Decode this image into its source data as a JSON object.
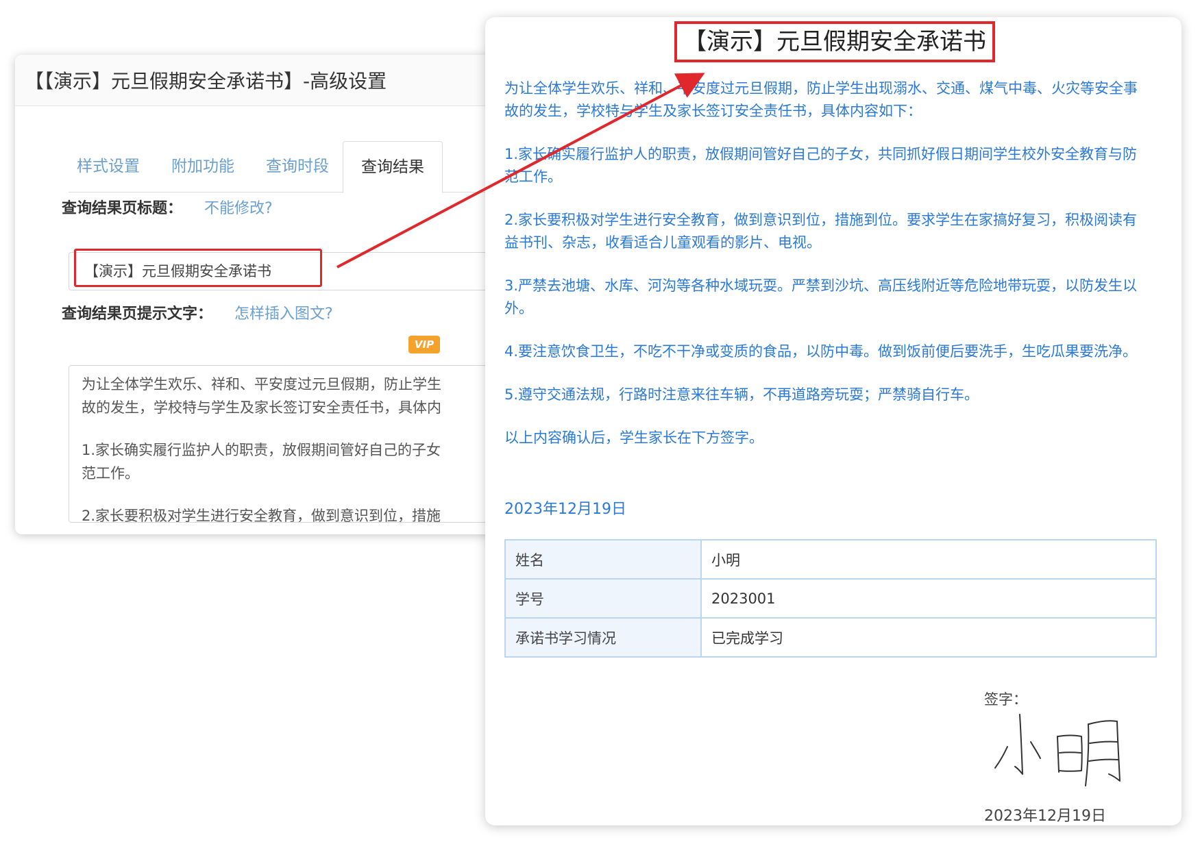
{
  "settings": {
    "header_title": "【【演示】元旦假期安全承诺书】-高级设置",
    "tabs": [
      {
        "label": "样式设置"
      },
      {
        "label": "附加功能"
      },
      {
        "label": "查询时段"
      },
      {
        "label": "查询结果"
      }
    ],
    "title_field": {
      "label": "查询结果页标题：",
      "help_link": "不能修改?",
      "value": "【演示】元旦假期安全承诺书"
    },
    "hint_field": {
      "label": "查询结果页提示文字：",
      "help_link": "怎样插入图文?",
      "vip_badge": "VIP",
      "lines": [
        "为让全体学生欢乐、祥和、平安度过元旦假期，防止学生",
        "故的发生，学校特与学生及家长签订安全责任书，具体内",
        "1.家长确实履行监护人的职责，放假期间管好自己的子女",
        "范工作。",
        "2.家长要积极对学生进行安全教育，做到意识到位，措施"
      ]
    }
  },
  "preview": {
    "title": "【演示】元旦假期安全承诺书",
    "paragraphs": [
      "为让全体学生欢乐、祥和、平安度过元旦假期，防止学生出现溺水、交通、煤气中毒、火灾等安全事故的发生，学校特与学生及家长签订安全责任书，具体内容如下：",
      "1.家长确实履行监护人的职责，放假期间管好自己的子女，共同抓好假日期间学生校外安全教育与防范工作。",
      "2.家长要积极对学生进行安全教育，做到意识到位，措施到位。要求学生在家搞好复习，积极阅读有益书刊、杂志，收看适合儿童观看的影片、电视。",
      "3.严禁去池塘、水库、河沟等各种水域玩耍。严禁到沙坑、高压线附近等危险地带玩耍，以防发生以外。",
      "4.要注意饮食卫生，不吃不干净或变质的食品，以防中毒。做到饭前便后要洗手，生吃瓜果要洗净。",
      "5.遵守交通法规，行路时注意来往车辆，不再道路旁玩耍；严禁骑自行车。",
      "以上内容确认后，学生家长在下方签字。"
    ],
    "date": "2023年12月19日",
    "table": [
      {
        "key": "姓名",
        "value": "小明"
      },
      {
        "key": "学号",
        "value": "2023001"
      },
      {
        "key": "承诺书学习情况",
        "value": "已完成学习"
      }
    ],
    "sign_label": "签字：",
    "signature_text": "小明",
    "sign_date": "2023年12月19日"
  },
  "colors": {
    "highlight_red": "#e0282c",
    "doc_blue": "#2a79d6",
    "link_blue": "#6a9fd0",
    "vip_orange": "#f5a22d"
  }
}
